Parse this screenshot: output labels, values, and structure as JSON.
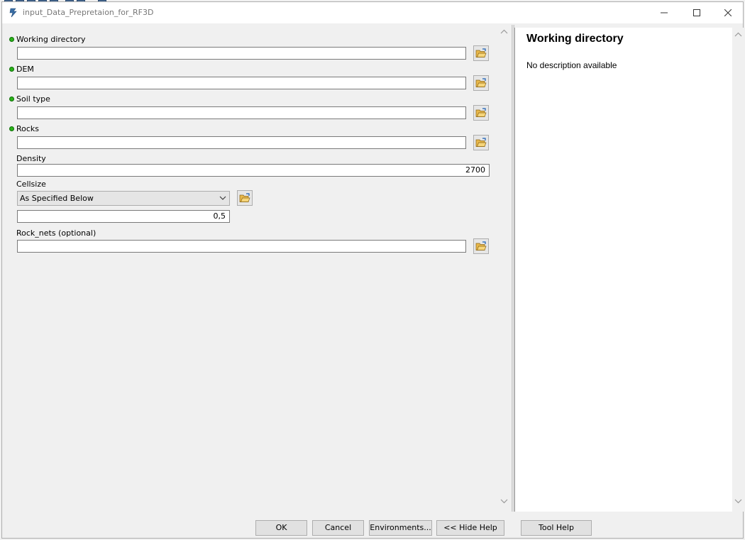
{
  "window": {
    "title": "input_Data_Prepretaion_for_RF3D"
  },
  "parameters": {
    "working_directory": {
      "label": "Working directory",
      "value": ""
    },
    "dem": {
      "label": "DEM",
      "value": ""
    },
    "soil_type": {
      "label": "Soil type",
      "value": ""
    },
    "rocks": {
      "label": "Rocks",
      "value": ""
    },
    "density": {
      "label": "Density",
      "value": "2700"
    },
    "cellsize": {
      "label": "Cellsize",
      "selected": "As Specified Below",
      "value": "0,5"
    },
    "rock_nets": {
      "label": "Rock_nets (optional)",
      "value": ""
    }
  },
  "help": {
    "title": "Working directory",
    "description": "No description available"
  },
  "buttons": {
    "ok": "OK",
    "cancel": "Cancel",
    "environments": "Environments...",
    "hide_help": "<< Hide Help",
    "tool_help": "Tool Help"
  },
  "icons": {
    "app": "model-tool-icon",
    "browse": "open-folder-icon",
    "required": "required-parameter-dot-icon"
  },
  "colors": {
    "required_dot": "#2bb31a",
    "folder": "#e8b84a"
  }
}
